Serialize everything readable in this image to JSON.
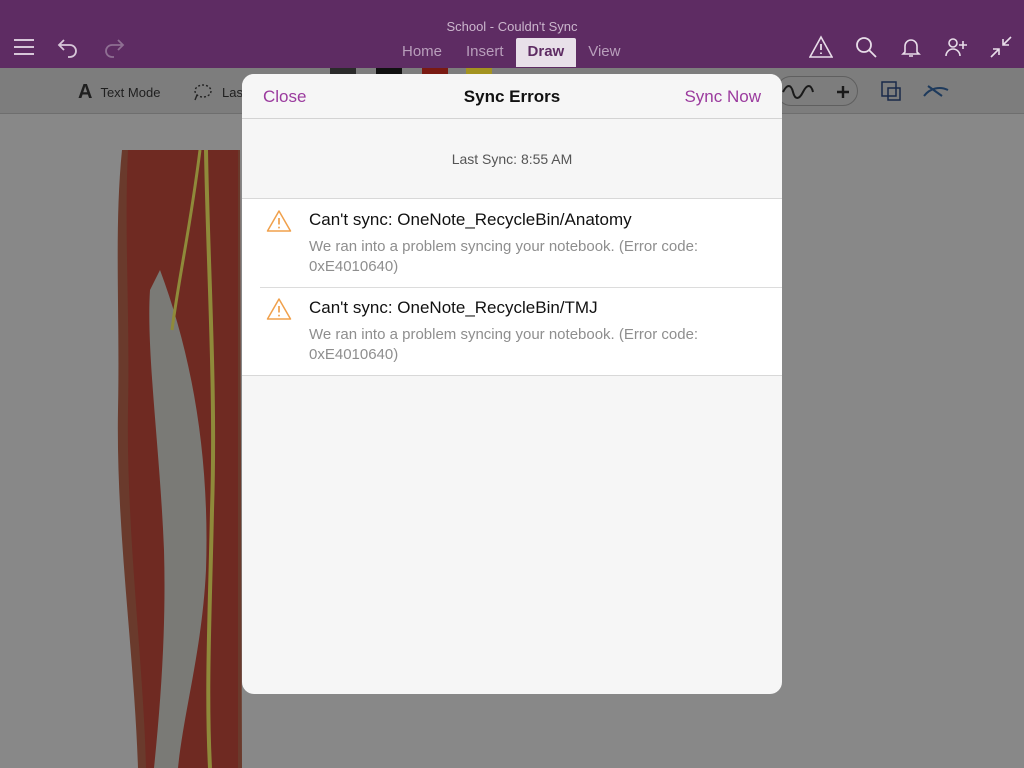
{
  "app": {
    "document_title": "School - Couldn't Sync",
    "tabs": [
      {
        "label": "Home"
      },
      {
        "label": "Insert"
      },
      {
        "label": "Draw",
        "active": true
      },
      {
        "label": "View"
      }
    ],
    "icons": {
      "menu": "hamburger-menu-icon",
      "undo": "undo-icon",
      "redo": "redo-icon",
      "sync_warning": "warning-icon",
      "search": "search-icon",
      "notifications": "bell-icon",
      "share": "add-person-icon",
      "collapse": "collapse-arrows-icon"
    },
    "colors": {
      "title_bar": "#5e2c63",
      "accent": "#9b3b9e",
      "warning": "#f0a04b"
    }
  },
  "ribbon": {
    "text_mode_label": "Text Mode",
    "lasso_label": "Las",
    "pen_colors": [
      "#2b2b2b",
      "#111111",
      "#7a1a12",
      "#a39320"
    ]
  },
  "dialog": {
    "close_label": "Close",
    "title": "Sync Errors",
    "sync_now_label": "Sync Now",
    "last_sync": "Last Sync: 8:55 AM",
    "errors": [
      {
        "title": "Can't sync: OneNote_RecycleBin/Anatomy",
        "desc_line1": "We ran into a problem syncing your notebook. (Error code:",
        "desc_line2": "0xE4010640)"
      },
      {
        "title": "Can't sync: OneNote_RecycleBin/TMJ",
        "desc_line1": "We ran into a problem syncing your notebook. (Error code:",
        "desc_line2": "0xE4010640)"
      }
    ]
  }
}
